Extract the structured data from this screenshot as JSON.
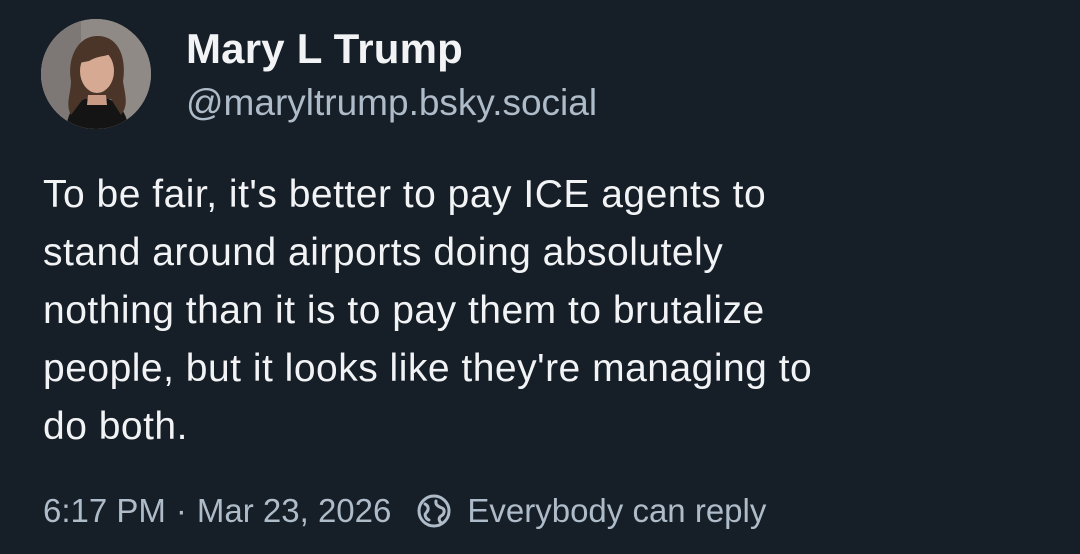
{
  "author": {
    "display_name": "Mary L Trump",
    "handle": "@maryltrump.bsky.social",
    "avatar_icon": "avatar-photo"
  },
  "post": {
    "text": "To be fair, it's better to pay ICE agents to\nstand around airports doing absolutely\nnothing than it is to pay them to brutalize\npeople, but it looks like they're managing to\ndo both."
  },
  "meta": {
    "time": "6:17 PM",
    "separator": "·",
    "date": "Mar 23, 2026",
    "reply_setting_icon": "globe-icon",
    "reply_setting": "Everybody can reply"
  },
  "colors": {
    "background": "#161e27",
    "primary_text": "#f1f3f5",
    "secondary_text": "#aebbc9"
  }
}
